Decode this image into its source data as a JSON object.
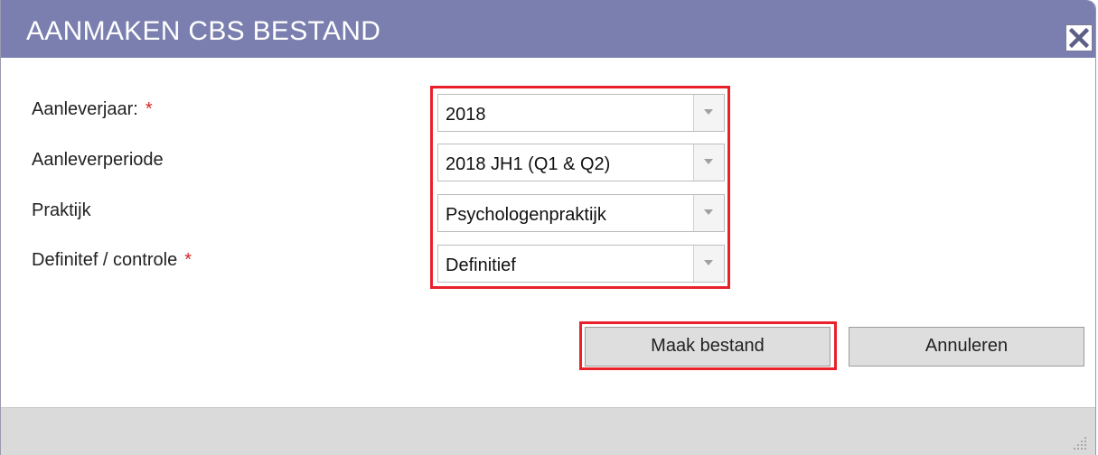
{
  "dialog": {
    "title": "AANMAKEN CBS BESTAND",
    "close_icon": "close-icon"
  },
  "form": {
    "fields": [
      {
        "label": "Aanleverjaar:",
        "required": "*",
        "value": "2018"
      },
      {
        "label": "Aanleverperiode",
        "required": "",
        "value": "2018 JH1 (Q1 & Q2)"
      },
      {
        "label": "Praktijk",
        "required": "",
        "value": "Psychologenpraktijk"
      },
      {
        "label": "Definitef / controle",
        "required": "*",
        "value": "Definitief"
      }
    ]
  },
  "actions": {
    "create_label": "Maak bestand",
    "cancel_label": "Annuleren"
  },
  "colors": {
    "titlebar": "#7a7faf",
    "highlight": "#e8212b",
    "required_marker": "#d42424"
  },
  "icons": {
    "dropdown": "chevron-down-icon",
    "resize": "resize-grip-icon"
  }
}
